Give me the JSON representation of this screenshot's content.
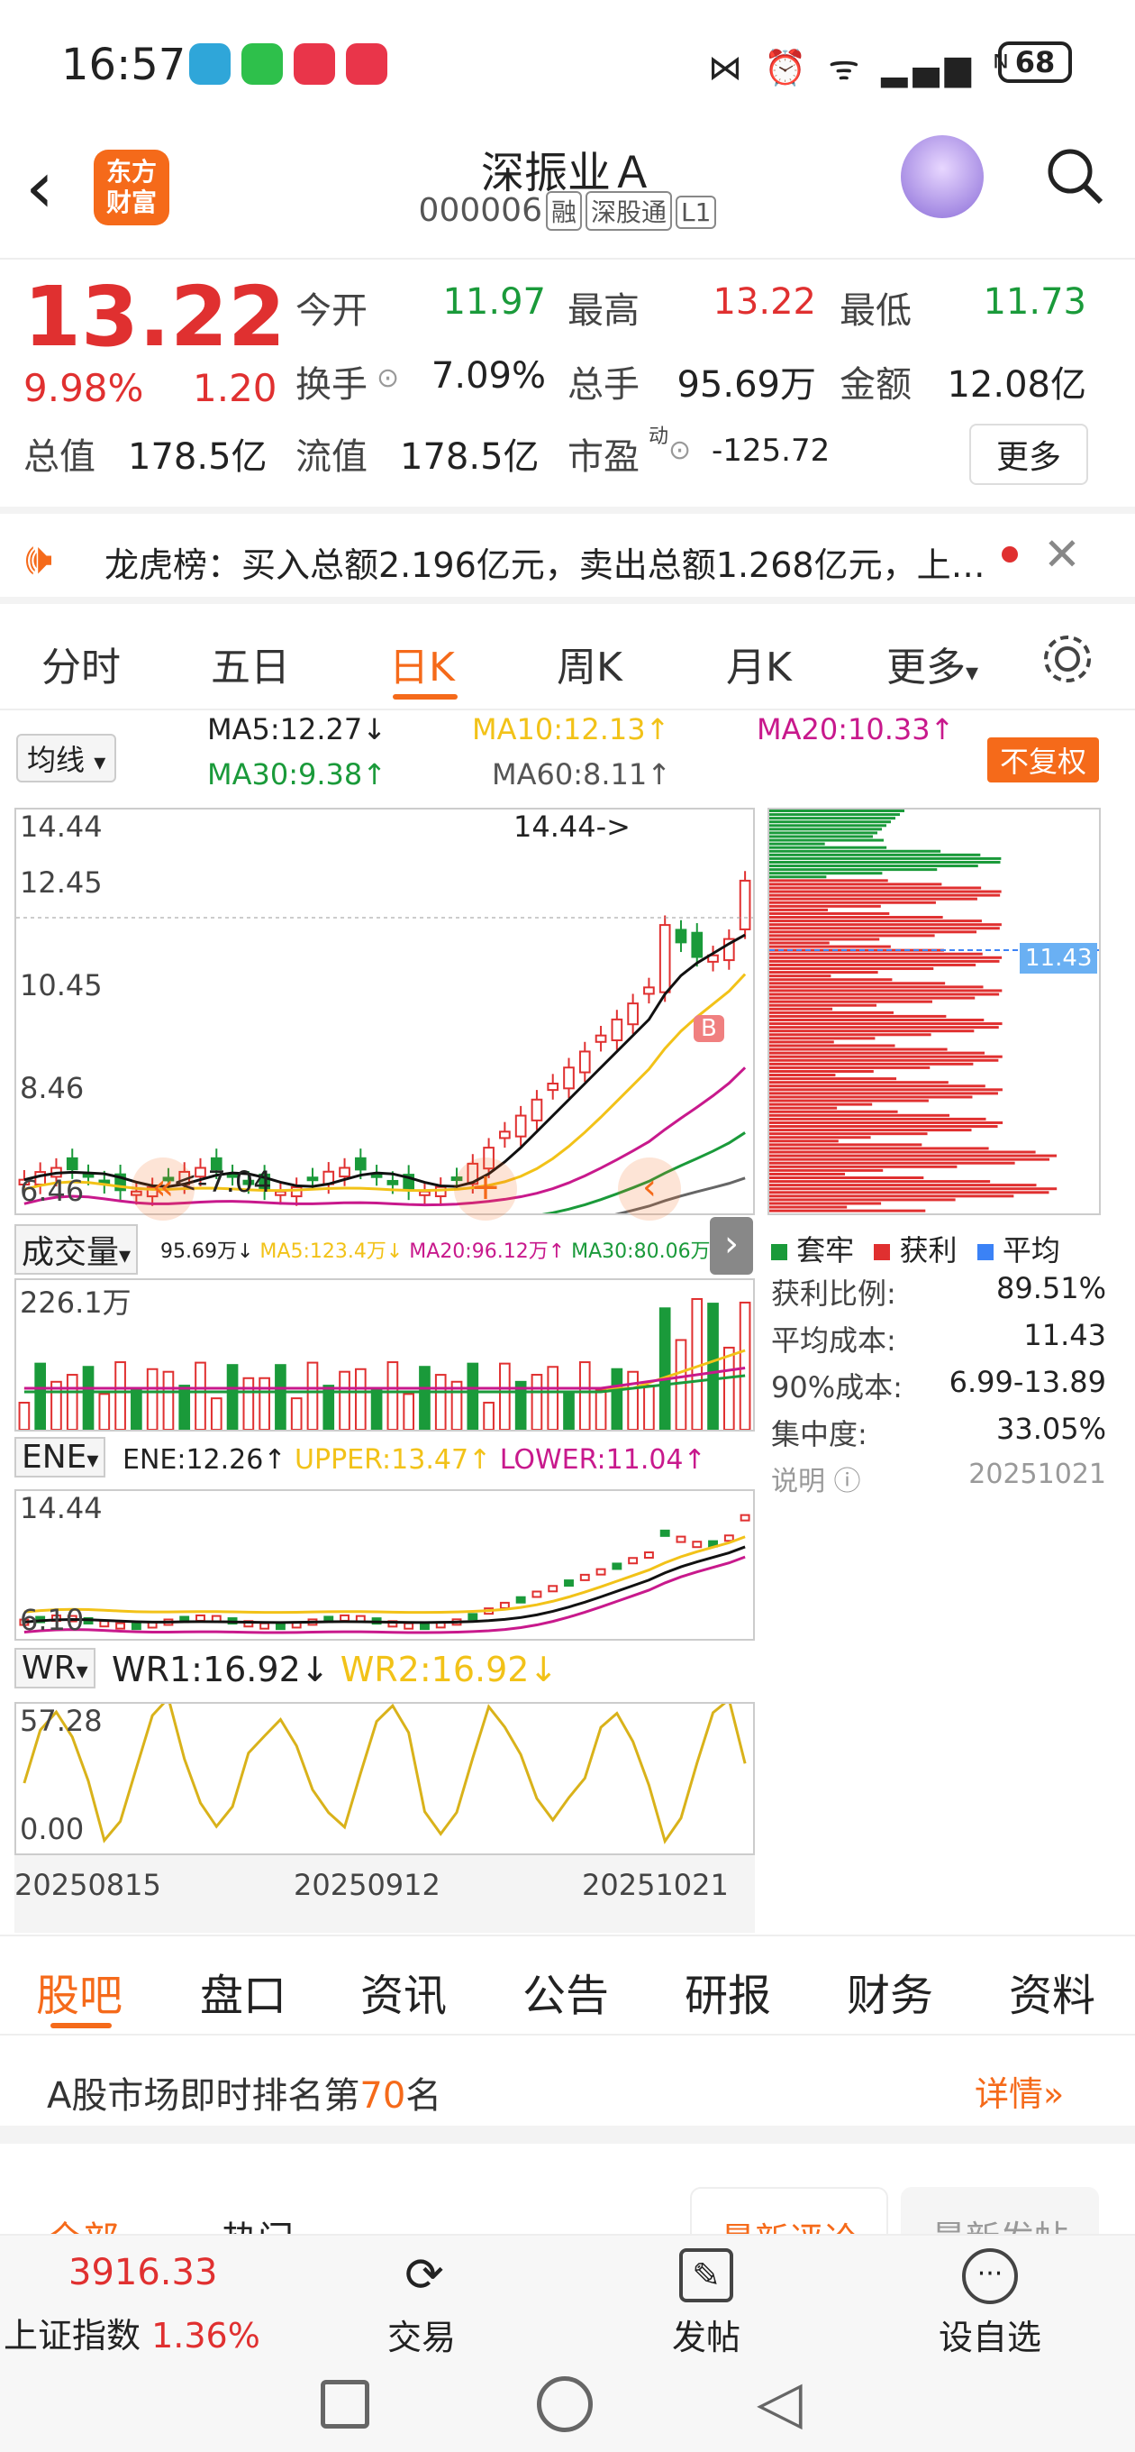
{
  "status": {
    "time": "16:57",
    "battery": "68"
  },
  "header": {
    "title": "深振业Ａ",
    "code": "000006",
    "tags": [
      "融",
      "深股通",
      "L1"
    ],
    "logo": "东方\n财富"
  },
  "quote": {
    "price": "13.22",
    "pct": "9.98%",
    "chg": "1.20",
    "rows": [
      [
        {
          "l": "今开",
          "v": "11.97",
          "c": "green"
        },
        {
          "l": "最高",
          "v": "13.22",
          "c": "red"
        },
        {
          "l": "最低",
          "v": "11.73",
          "c": "green"
        }
      ],
      [
        {
          "l": "换手",
          "v": "7.09%",
          "c": "black"
        },
        {
          "l": "总手",
          "v": "95.69万",
          "c": "black"
        },
        {
          "l": "金额",
          "v": "12.08亿",
          "c": "black"
        }
      ]
    ],
    "total_cap_l": "总值",
    "total_cap": "178.5亿",
    "float_cap_l": "流值",
    "float_cap": "178.5亿",
    "pe_l": "市盈",
    "pe_sup": "动",
    "pe": "-125.72",
    "more": "更多"
  },
  "notice": {
    "text": "龙虎榜：买入总额2.196亿元，卖出总额1.268亿元，上…"
  },
  "tabs": [
    "分时",
    "五日",
    "日K",
    "周K",
    "月K",
    "更多"
  ],
  "ma": {
    "btn": "均线",
    "ma5": "MA5:12.27↓",
    "ma10": "MA10:12.13↑",
    "ma20": "MA20:10.33↑",
    "ma30": "MA30:9.38↑",
    "ma60": "MA60:8.11↑",
    "fq": "不复权"
  },
  "kline": {
    "yticks": [
      "14.44",
      "12.45",
      "10.45",
      "8.46",
      "6.46"
    ],
    "high_label": "14.44->",
    "low_label": "<-7.04",
    "marker": "B"
  },
  "chip": {
    "avg_label": "11.43",
    "legend": [
      "套牢",
      "获利",
      "平均"
    ],
    "stats": [
      {
        "k": "获利比例:",
        "v": "89.51%"
      },
      {
        "k": "平均成本:",
        "v": "11.43"
      },
      {
        "k": "90%成本:",
        "v": "6.99-13.89"
      },
      {
        "k": "集中度:",
        "v": "33.05%"
      },
      {
        "k": "说明",
        "v": "20251021"
      }
    ]
  },
  "vol": {
    "btn": "成交量",
    "text": "95.69万↓",
    "ma5": "MA5:123.4万↓",
    "ma20": "MA20:96.12万↑",
    "ma30": "MA30:80.06万↑",
    "ytop": "226.1万"
  },
  "ene": {
    "btn": "ENE",
    "ene": "ENE:12.26↑",
    "upper": "UPPER:13.47↑",
    "lower": "LOWER:11.04↑",
    "ytop": "14.44",
    "ybot": "6.10"
  },
  "wr": {
    "btn": "WR",
    "wr1": "WR1:16.92↓",
    "wr2": "WR2:16.92↓",
    "ytop": "57.28",
    "ybot": "0.00"
  },
  "dates": [
    "20250815",
    "20250912",
    "20251021"
  ],
  "btabs": [
    "股吧",
    "盘口",
    "资讯",
    "公告",
    "研报",
    "财务",
    "资料"
  ],
  "rank": {
    "pre": "A股市场即时排名第",
    "num": "70",
    "post": "名",
    "link": "详情"
  },
  "sub": {
    "all": "全部",
    "hot": "热门",
    "newc": "最新评论",
    "newp": "最新发帖"
  },
  "bottom": {
    "idx_val": "3916.33",
    "idx_name": "上证指数",
    "idx_pct": "1.36%",
    "trade": "交易",
    "post": "发帖",
    "watch": "设自选"
  },
  "colors": {
    "up": "#e03030",
    "down": "#1a9a3a",
    "accent": "#f56a1a",
    "ma10": "#f2c218",
    "ma20": "#c8198c",
    "ma30": "#1a9a3a"
  }
}
